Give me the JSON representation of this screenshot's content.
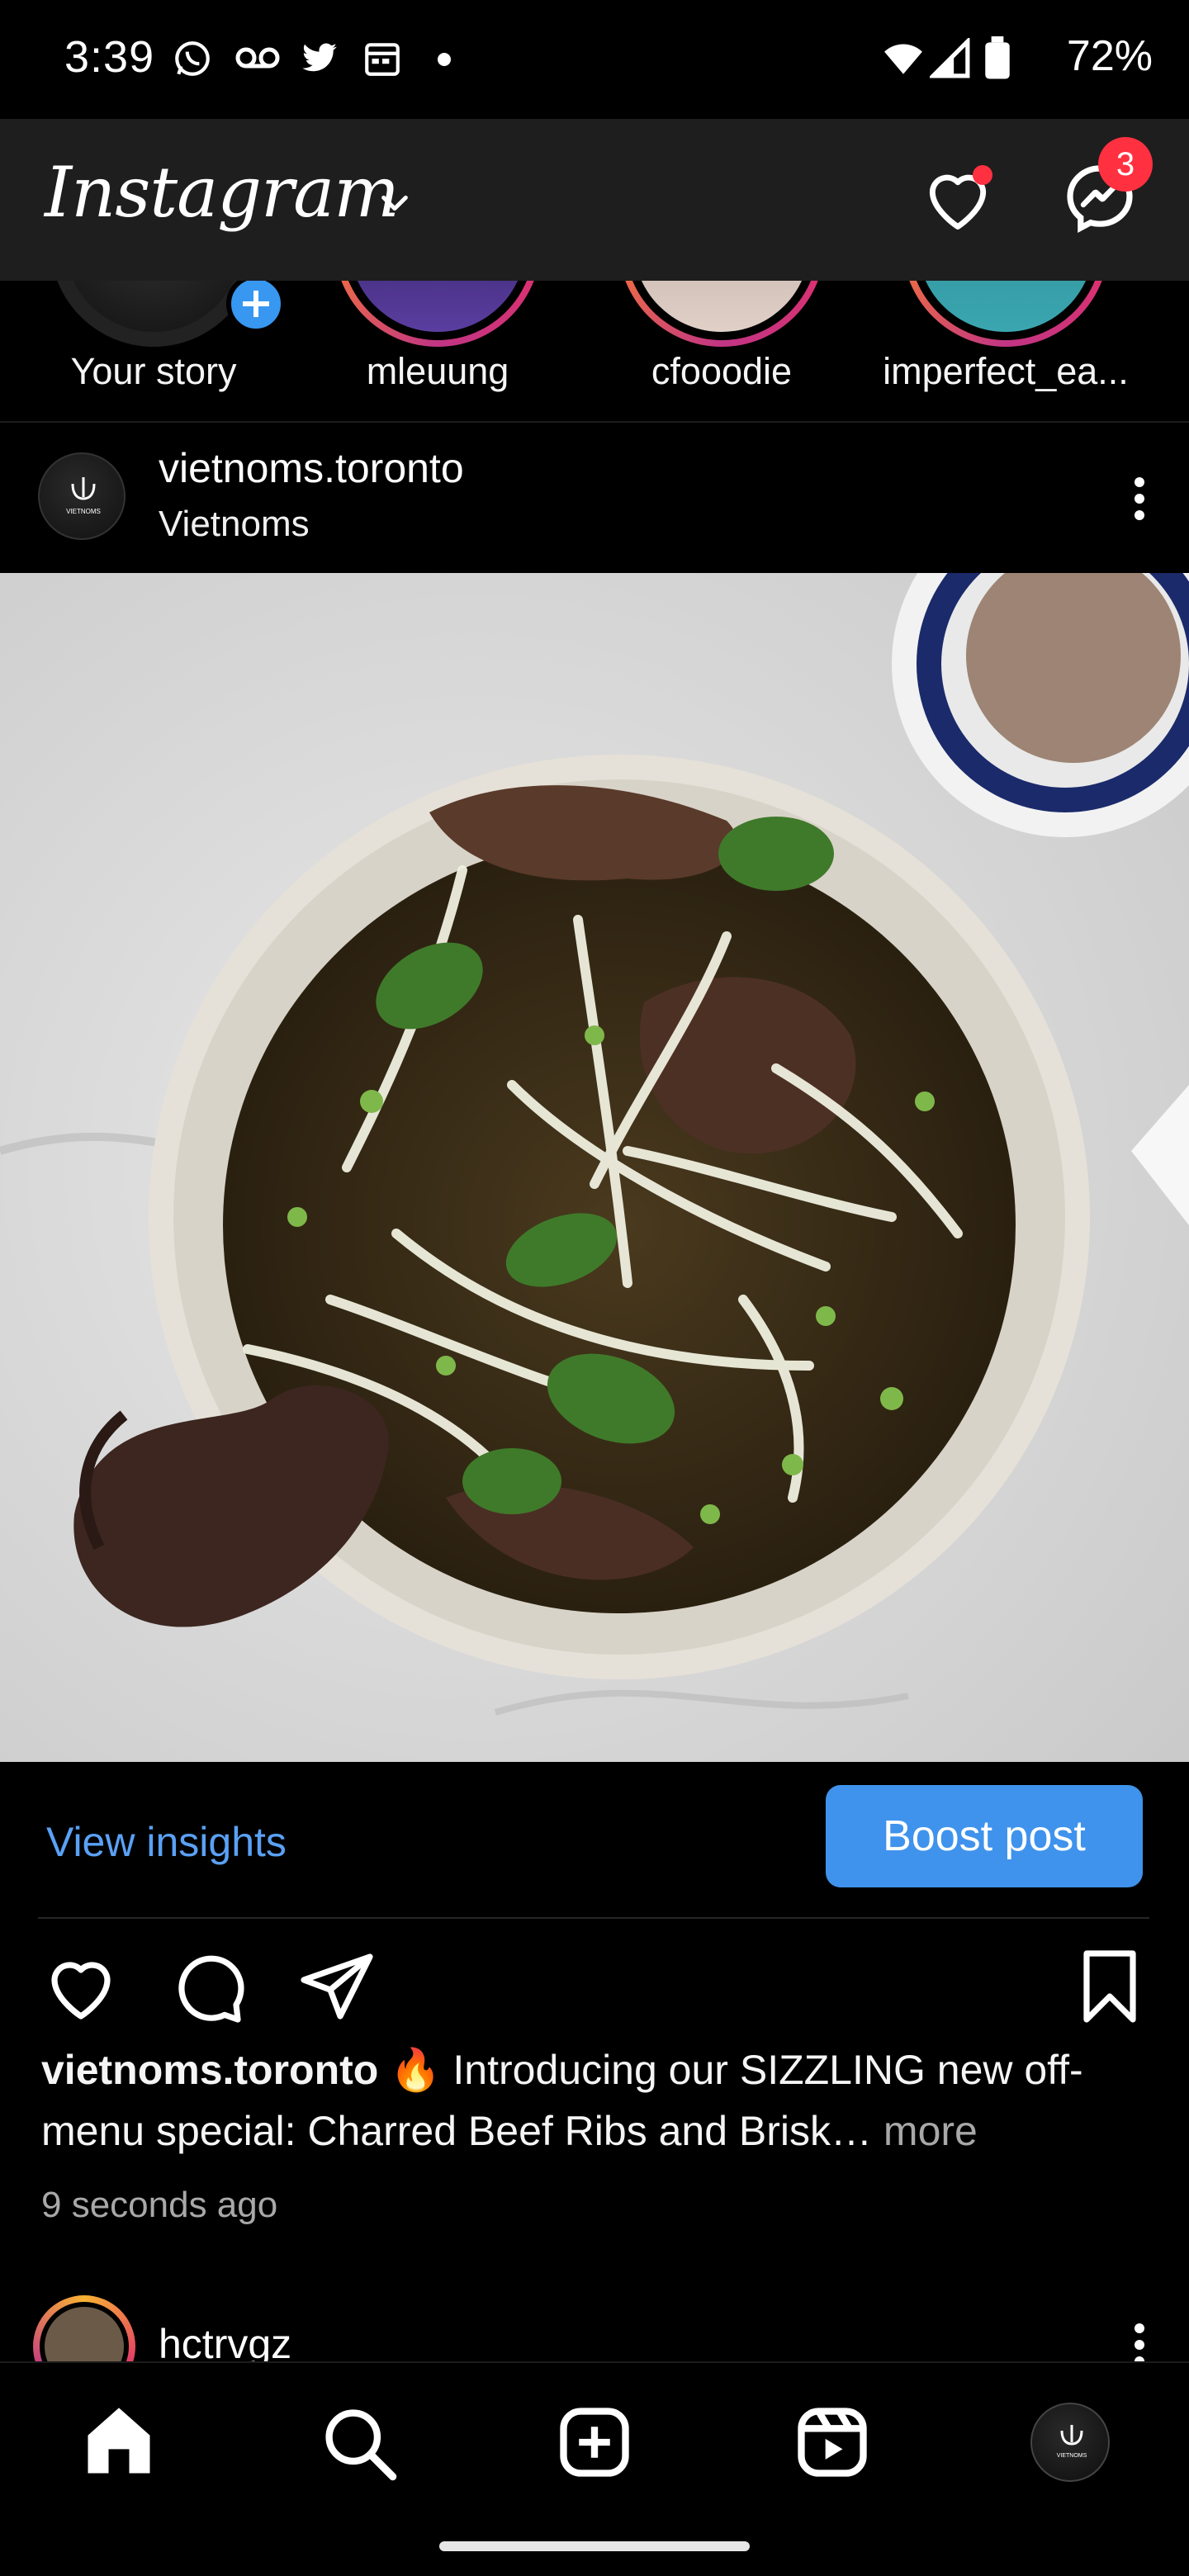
{
  "status_bar": {
    "time": "3:39",
    "battery": "72%",
    "icons": [
      "whatsapp-icon",
      "voicemail-icon",
      "twitter-icon",
      "calendar-icon",
      "dot-icon",
      "wifi-icon",
      "cell-signal-icon",
      "battery-icon"
    ]
  },
  "header": {
    "logo": "Instagram",
    "messages_badge": "3",
    "colors": {
      "badge": "#ff3040",
      "background": "#1e1e1e"
    }
  },
  "stories": [
    {
      "label": "Your story"
    },
    {
      "label": "mleuung"
    },
    {
      "label": "cfooodie"
    },
    {
      "label": "imperfect_ea..."
    }
  ],
  "post": {
    "username": "vietnoms.toronto",
    "location": "Vietnoms",
    "avatar_text": "VIETNOMS",
    "view_insights": "View insights",
    "boost_label": "Boost post",
    "caption_user": "vietnoms.toronto",
    "caption_emoji": "🔥",
    "caption_text": "Introducing our SIZZLING new off-menu special: Charred Beef Ribs and Brisk…",
    "caption_more": "more",
    "timestamp": "9 seconds ago",
    "colors": {
      "link": "#5aa1f5",
      "button": "#3f93ec"
    }
  },
  "next_post": {
    "username": "hctrvgz"
  },
  "bottom_nav": {
    "items": [
      "home-icon",
      "search-icon",
      "create-icon",
      "reels-icon",
      "profile-avatar"
    ]
  }
}
